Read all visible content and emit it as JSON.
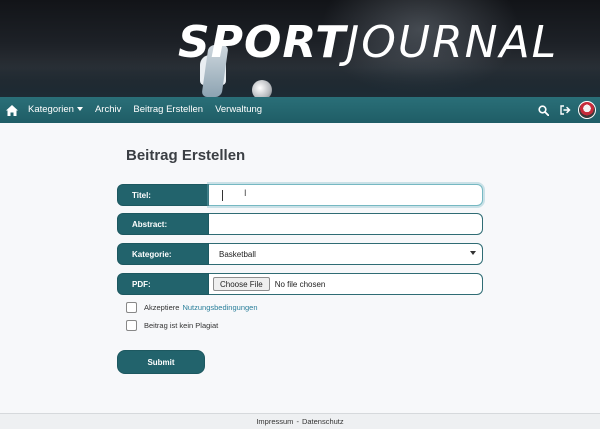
{
  "banner": {
    "title_bold": "SPORT",
    "title_thin": "JOURNAL"
  },
  "navbar": {
    "home_icon": "home-icon",
    "items": [
      "Kategorien",
      "Archiv",
      "Beitrag Erstellen",
      "Verwaltung"
    ],
    "right_icons": [
      "search-icon",
      "logout-icon",
      "avatar"
    ]
  },
  "page": {
    "title": "Beitrag Erstellen"
  },
  "form": {
    "title_label": "Titel:",
    "title_value": "",
    "abstract_label": "Abstract:",
    "abstract_value": "",
    "category_label": "Kategorie:",
    "category_value": "Basketball",
    "pdf_label": "PDF:",
    "file_button": "Choose File",
    "file_status": "No file chosen",
    "terms_prefix": "Akzeptiere",
    "terms_link": "Nutzungsbedingungen",
    "plagiarism_label": "Beitrag ist kein Plagiat",
    "submit_label": "Submit"
  },
  "footer": {
    "impressum": "Impressum",
    "separator": "-",
    "datenschutz": "Datenschutz"
  },
  "colors": {
    "primary": "#22636c",
    "navbar": "#236670",
    "link": "#2a7f9a",
    "background": "#f7f8fa"
  }
}
